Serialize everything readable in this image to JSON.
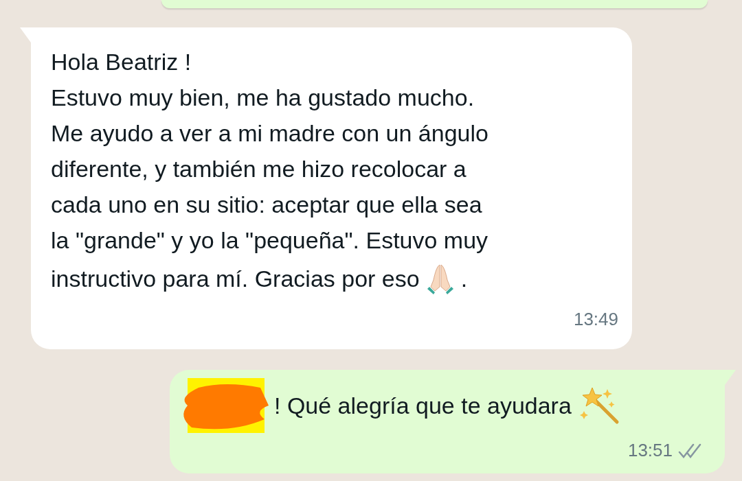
{
  "messages": [
    {
      "kind": "cut_off",
      "outgoing": true
    },
    {
      "kind": "text",
      "outgoing": false,
      "lines": [
        "Hola Beatriz !",
        "Estuvo muy bien, me ha gustado mucho.",
        "Me ayudo a ver a mi madre con un ángulo",
        "diferente, y también me hizo recolocar a",
        "cada uno en su sitio: aceptar que ella sea",
        "la \"grande\" y yo la \"pequeña\". Estuvo muy"
      ],
      "last_line": "instructivo para mí. Gracias por eso",
      "emoji": {
        "kind": "pray"
      },
      "after_emoji": ".",
      "time": "13:49"
    },
    {
      "kind": "redacted",
      "outgoing": true,
      "text": "! Qué alegría que te ayudara",
      "emoji": {
        "kind": "wand"
      },
      "time": "13:51",
      "read": false
    }
  ]
}
